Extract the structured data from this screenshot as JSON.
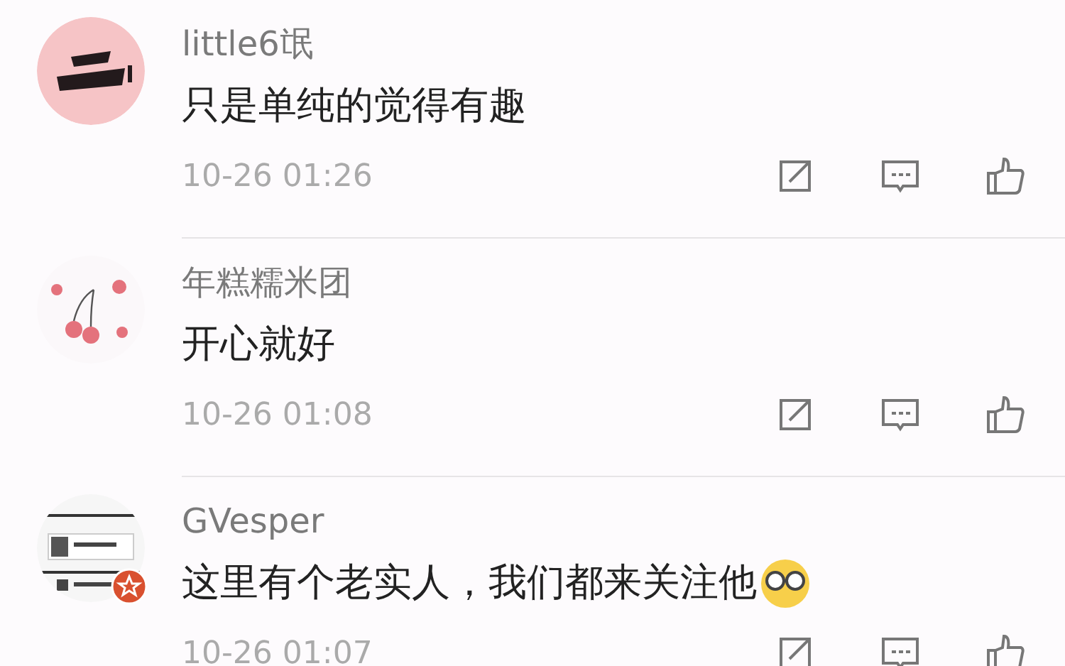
{
  "comments": [
    {
      "user": "little6氓",
      "text": "只是单纯的觉得有趣",
      "emoji": false,
      "time": "10-26 01:26",
      "avatar": {
        "verified": false
      }
    },
    {
      "user": "年糕糯米团",
      "text": "开心就好",
      "emoji": false,
      "time": "10-26 01:08",
      "avatar": {
        "verified": false
      }
    },
    {
      "user": "GVesper",
      "text": "这里有个老实人，我们都来关注他",
      "emoji": true,
      "time": "10-26 01:07",
      "avatar": {
        "verified": true
      }
    }
  ]
}
